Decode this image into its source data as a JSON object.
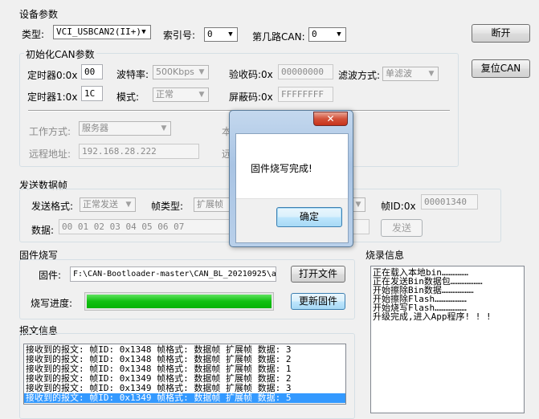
{
  "device": {
    "group_title": "设备参数",
    "type_label": "类型:",
    "type_value": "VCI_USBCAN2(II+)",
    "index_label": "索引号:",
    "index_value": "0",
    "channel_label": "第几路CAN:",
    "channel_value": "0",
    "disconnect_label": "断开",
    "reset_label": "复位CAN"
  },
  "init": {
    "group_title": "初始化CAN参数",
    "timer0_label": "定时器0:0x",
    "timer0_value": "00",
    "baud_label": "波特率:",
    "baud_value": "500Kbps",
    "acc_code_label": "验收码:0x",
    "acc_code_value": "00000000",
    "filter_label": "滤波方式:",
    "filter_value": "单滤波",
    "timer1_label": "定时器1:0x",
    "timer1_value": "1C",
    "mode_label": "模式:",
    "mode_value": "正常",
    "mask_label": "屏蔽码:0x",
    "mask_value": "FFFFFFFF",
    "work_mode_label": "工作方式:",
    "work_mode_value": "服务器",
    "remote_addr_label": "远程地址:",
    "remote_addr_value": "192.168.28.222",
    "hidden_label_1": "本",
    "hidden_label_2": "远"
  },
  "send": {
    "group_title": "发送数据帧",
    "format_label": "发送格式:",
    "format_value": "正常发送",
    "frame_type_label": "帧类型:",
    "frame_type_value": "扩展帧",
    "frame_id_label": "帧ID:0x",
    "frame_id_value": "00001340",
    "data_label": "数据:",
    "data_value": "00 01 02 03 04 05 06 07",
    "send_button": "发送"
  },
  "firmware": {
    "group_title": "固件烧写",
    "file_label": "固件:",
    "file_path": "F:\\CAN-Bootloader-master\\CAN_BL_20210925\\a",
    "open_button": "打开文件",
    "progress_label": "烧写进度:",
    "progress_percent": 100,
    "update_button": "更新固件"
  },
  "burn_log": {
    "group_title": "烧录信息",
    "lines": [
      "正在载入本地bin……………",
      "正在发送Bin数据包………………",
      "开始擦除Bin数据………………",
      "开始擦除Flash………………",
      "开始烧写Flash………………",
      "升级完成,进入App程序! ! !"
    ]
  },
  "messages": {
    "group_title": "报文信息",
    "rows": [
      "接收到的报文:  帧ID: 0x1348  帧格式: 数据帧  扩展帧   数据: 3",
      "接收到的报文:  帧ID: 0x1348  帧格式: 数据帧  扩展帧   数据: 2",
      "接收到的报文:  帧ID: 0x1348  帧格式: 数据帧  扩展帧   数据: 1",
      "接收到的报文:  帧ID: 0x1349  帧格式: 数据帧  扩展帧   数据: 2",
      "接收到的报文:  帧ID: 0x1349  帧格式: 数据帧  扩展帧   数据: 3",
      "接收到的报文:  帧ID: 0x1349  帧格式: 数据帧  扩展帧   数据: 5"
    ],
    "selected_index": 5
  },
  "dialog": {
    "message": "固件烧写完成!",
    "ok_label": "确定",
    "close_symbol": "✕"
  }
}
